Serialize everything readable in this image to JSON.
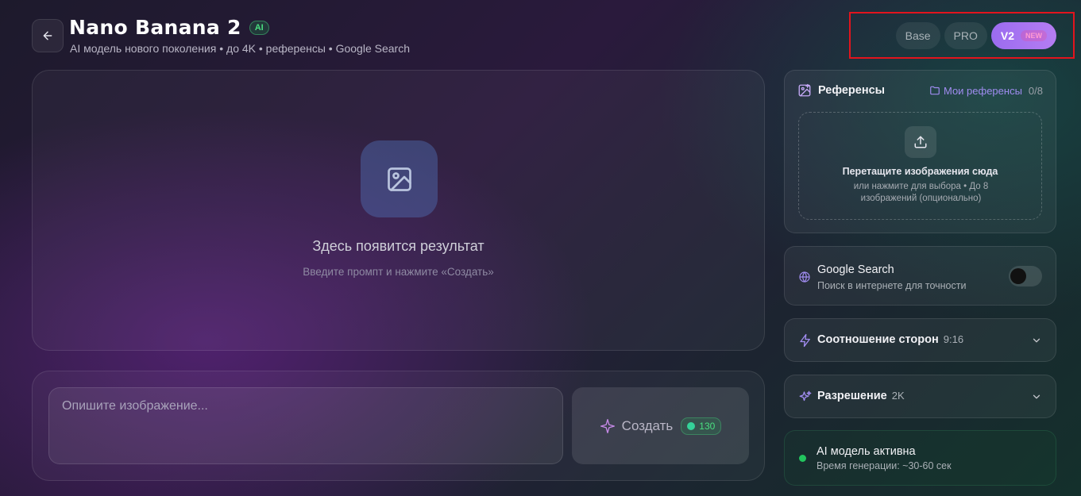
{
  "header": {
    "title": "Nano Banana 2",
    "badge": "AI",
    "subtitle": "AI модель нового поколения • до 4K • референсы • Google Search"
  },
  "versions": [
    {
      "label": "Base"
    },
    {
      "label": "PRO"
    },
    {
      "label": "V2",
      "badge": "NEW",
      "active": true
    }
  ],
  "result": {
    "title": "Здесь появится результат",
    "hint": "Введите промпт и нажмите «Создать»"
  },
  "prompt": {
    "placeholder": "Опишите изображение...",
    "create_label": "Создать",
    "cost": "130"
  },
  "references": {
    "title": "Референсы",
    "my_refs_label": "Мои референсы",
    "count": "0/8",
    "drop_title": "Перетащите изображения сюда",
    "drop_hint": "или нажмите для выбора • До 8 изображений (опционально)"
  },
  "google_search": {
    "title": "Google Search",
    "subtitle": "Поиск в интернете для точности",
    "enabled": false
  },
  "aspect_ratio": {
    "title": "Соотношение сторон",
    "value": "9:16"
  },
  "resolution": {
    "title": "Разрешение",
    "value": "2K"
  },
  "status": {
    "title": "AI модель активна",
    "subtitle": "Время генерации: ~30-60 сек"
  },
  "colors": {
    "accent": "#9b6cf0",
    "success": "#22c55e",
    "highlight": "#e2141d"
  }
}
